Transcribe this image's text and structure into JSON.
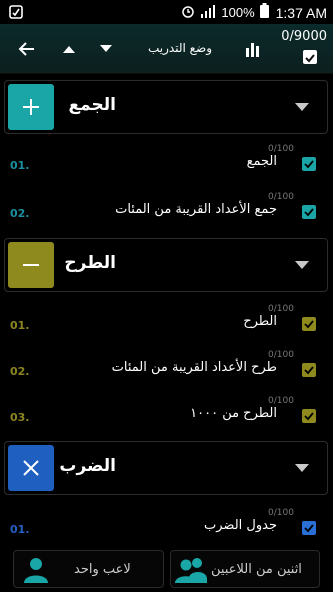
{
  "status_bar": {
    "battery": "100%",
    "time": "1:37 AM"
  },
  "toolbar": {
    "title": "وضع التدريب",
    "counter": "0/9000"
  },
  "categories": [
    {
      "title": "الجمع",
      "color": "#1aa6a6",
      "icon": "plus-icon",
      "items": [
        {
          "num": "01.",
          "label": "الجمع",
          "score": "0/100",
          "num_color": "#1a8f9f"
        },
        {
          "num": "02.",
          "label": "جمع الأعداد القريبة من المئات",
          "score": "0/100",
          "num_color": "#1a8f9f"
        }
      ]
    },
    {
      "title": "الطرح",
      "color": "#8e8a1e",
      "icon": "minus-icon",
      "items": [
        {
          "num": "01.",
          "label": "الطرح",
          "score": "0/100",
          "num_color": "#8c8420"
        },
        {
          "num": "02.",
          "label": "طرح الأعداد القريبة من المئات",
          "score": "0/100",
          "num_color": "#8c8420"
        },
        {
          "num": "03.",
          "label": "الطرح من ١٠٠٠",
          "score": "0/100",
          "num_color": "#8c8420"
        }
      ]
    },
    {
      "title": "الضرب",
      "color": "#1f5fbf",
      "icon": "times-icon",
      "items": [
        {
          "num": "01.",
          "label": "جدول الضرب",
          "score": "0/100",
          "num_color": "#2460c4"
        }
      ]
    }
  ],
  "bottom": {
    "single_player": "لاعب واحد",
    "two_players": "اثنين من اللاعبين"
  }
}
